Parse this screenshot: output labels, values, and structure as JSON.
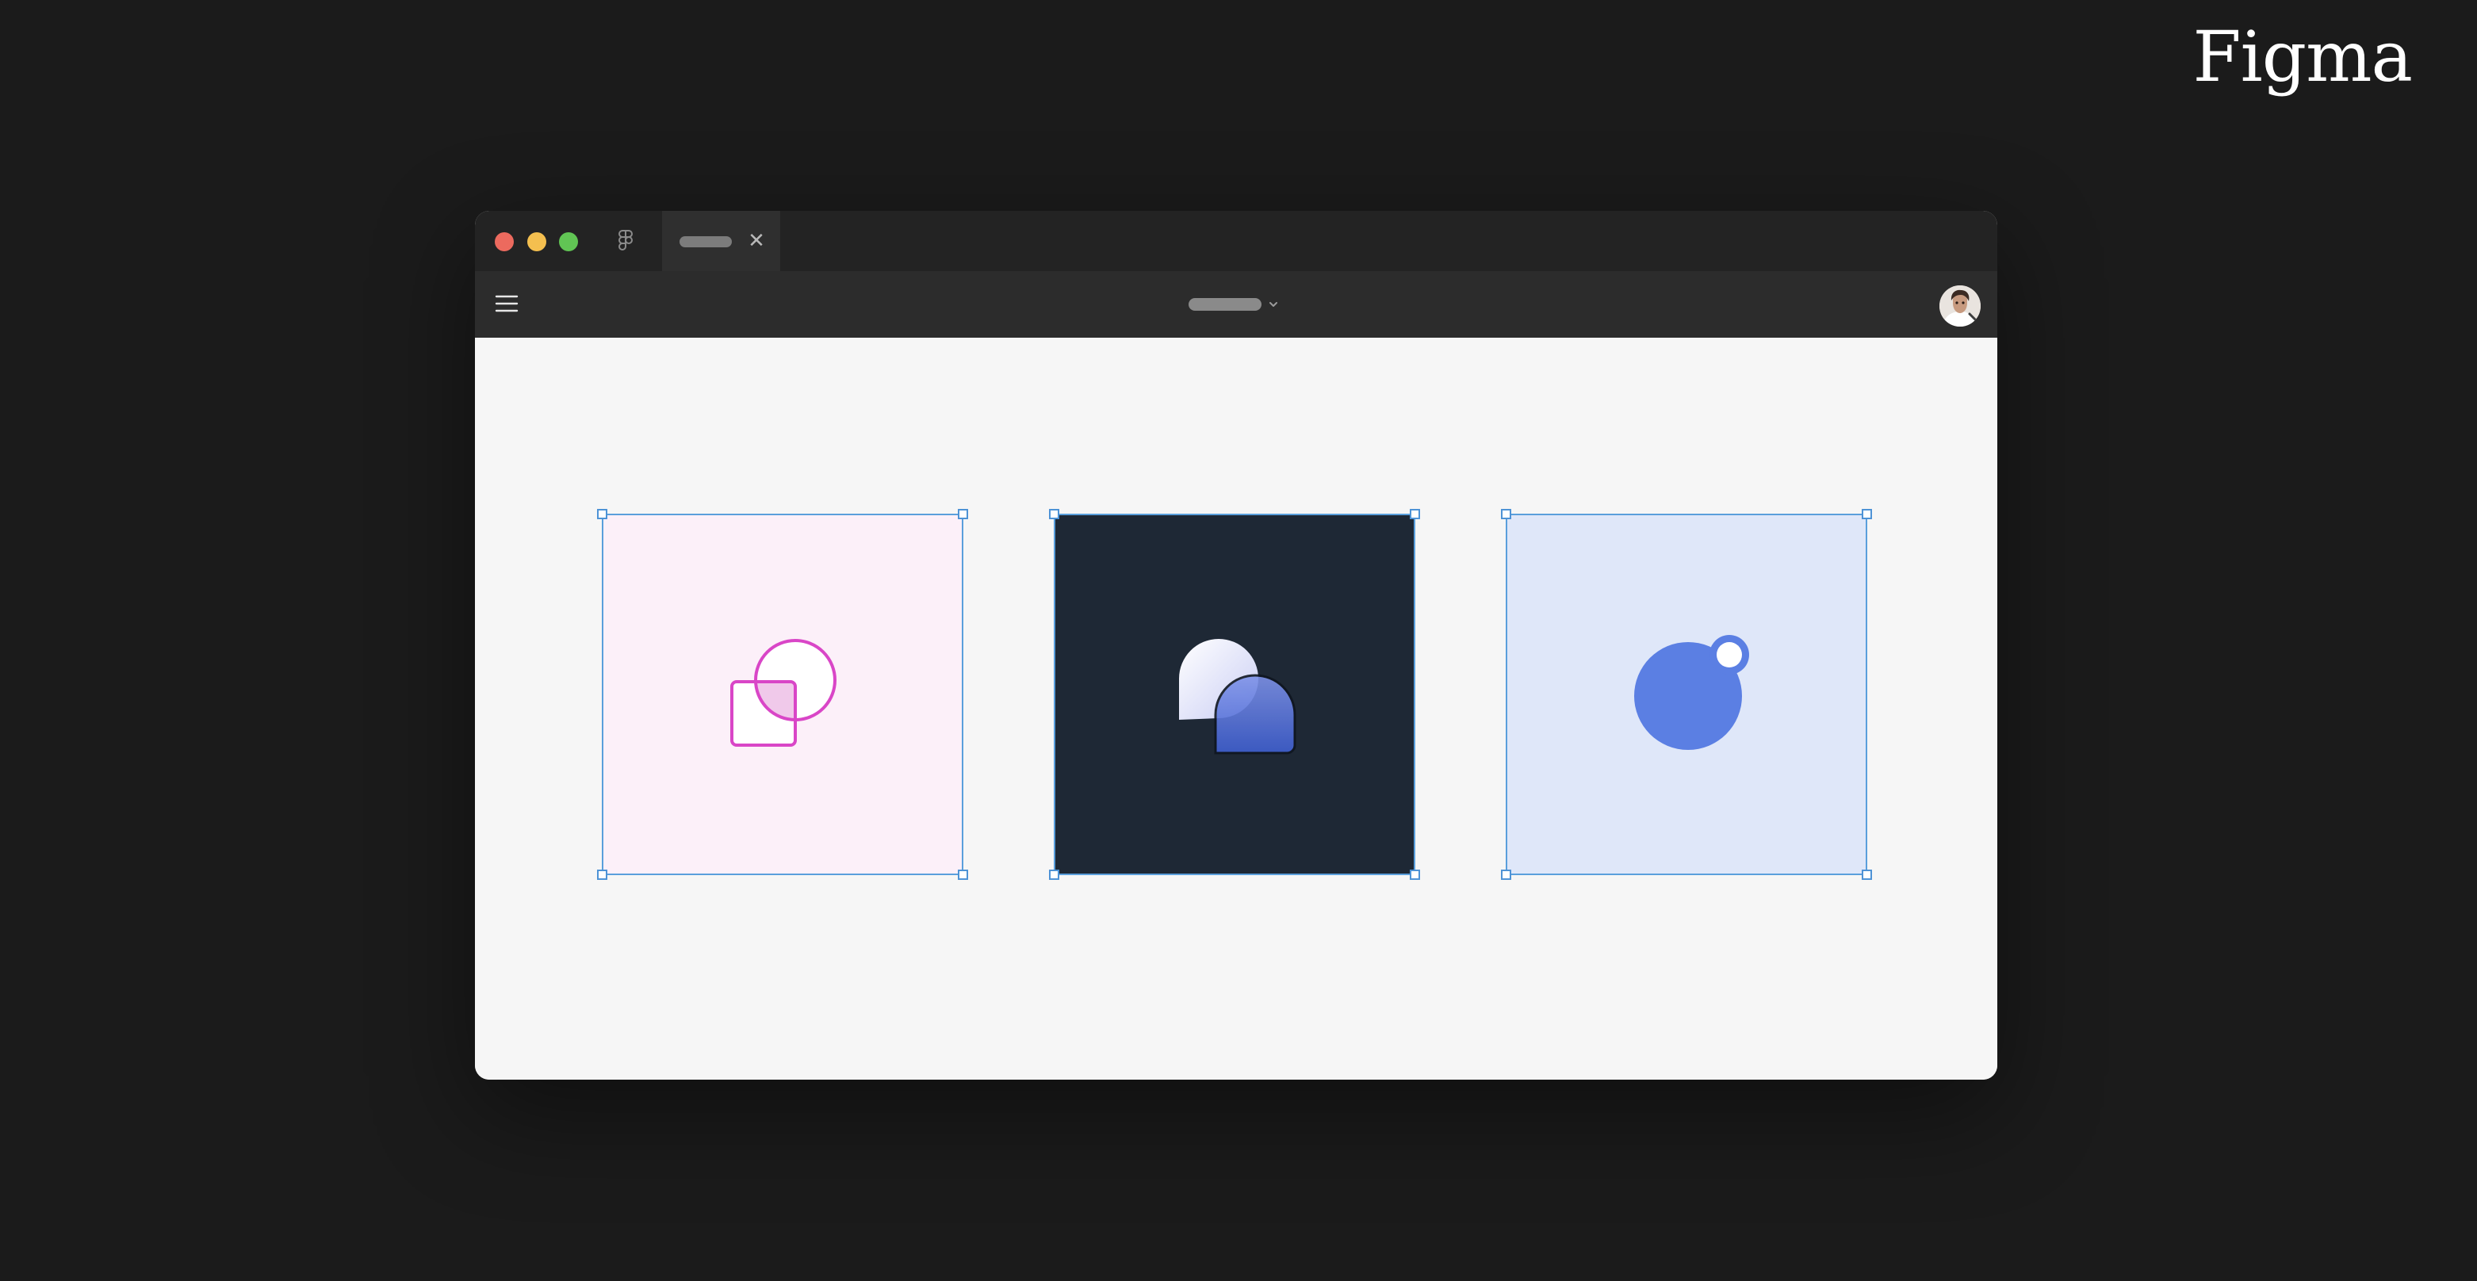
{
  "brand": {
    "logo_text": "Figma"
  },
  "window": {
    "titlebar": {
      "traffic_lights": [
        "close",
        "minimize",
        "zoom"
      ],
      "app_icon": "figma-logo-icon",
      "tab": {
        "close_icon": "close-icon",
        "close_glyph": "✕"
      }
    },
    "toolbar": {
      "menu_icon": "hamburger-menu-icon",
      "file_menu_icon": "chevron-down-icon",
      "avatar": "user-avatar"
    }
  },
  "canvas": {
    "frames": [
      {
        "name": "pink-frame",
        "fill": "#fcf0f9",
        "stroke": "#d946c7",
        "icon": "shapes-outline-icon"
      },
      {
        "name": "navy-frame",
        "fill": "#1e2835",
        "stroke": "#3f5fd0",
        "icon": "shapes-gradient-icon"
      },
      {
        "name": "blue-frame",
        "fill": "#dfe7f9",
        "stroke": "#5b7fe3",
        "icon": "circle-badge-icon"
      }
    ]
  },
  "colors": {
    "background": "#1b1b1b",
    "selection": "#5a9fdc",
    "titlebar": "#232323",
    "toolbar": "#2c2c2c",
    "canvas": "#f6f6f6"
  }
}
